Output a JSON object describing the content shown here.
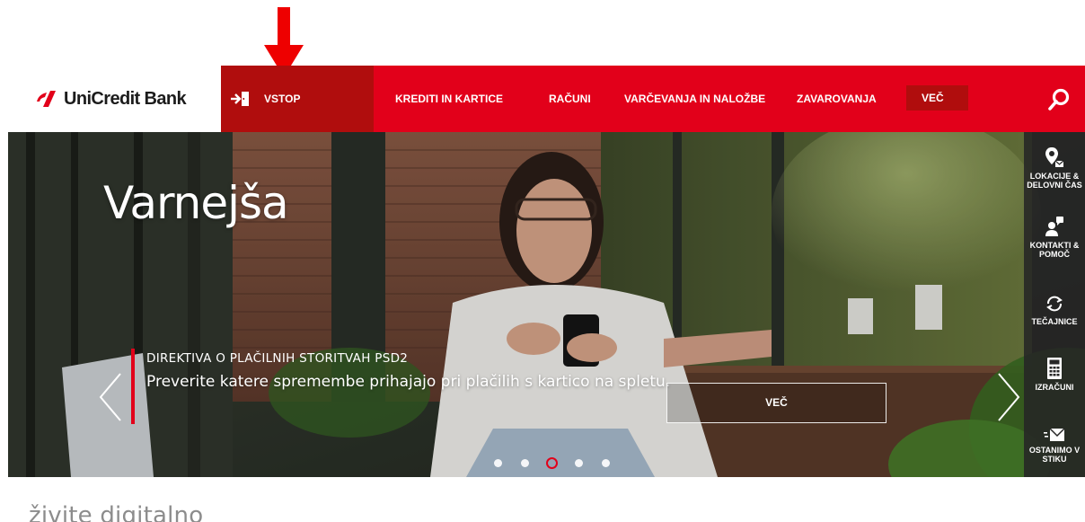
{
  "header": {
    "logo_text": "UniCredit Bank",
    "login_label": "VSTOP",
    "nav": [
      {
        "label": "KREDITI IN KARTICE"
      },
      {
        "label": "RAČUNI"
      },
      {
        "label": "VARČEVANJA IN NALOŽBE"
      },
      {
        "label": "ZAVAROVANJA"
      }
    ],
    "more_label": "VEČ"
  },
  "hero": {
    "title": "Varnejša",
    "kicker": "DIREKTIVA O PLAČILNIH STORITVAH PSD2",
    "text": "Preverite katere spremembe prihajajo pri plačilih s kartico na spletu.",
    "button_label": "VEČ",
    "slides": {
      "count": 5,
      "active": 3
    }
  },
  "side_panel": [
    {
      "icon": "location-icon",
      "label": "LOKACIJE &\nDELOVNI ČAS"
    },
    {
      "icon": "contact-icon",
      "label": "KONTAKTI &\nPOMOČ"
    },
    {
      "icon": "exchange-icon",
      "label": "TEČAJNICE"
    },
    {
      "icon": "calculator-icon",
      "label": "IZRAČUNI"
    },
    {
      "icon": "mail-icon",
      "label": "OSTANIMO V\nSTIKU"
    }
  ],
  "section": {
    "heading": "živite digitalno"
  },
  "colors": {
    "brand_red": "#e2001a",
    "dark_red": "#b00d0d",
    "panel": "#262626"
  }
}
